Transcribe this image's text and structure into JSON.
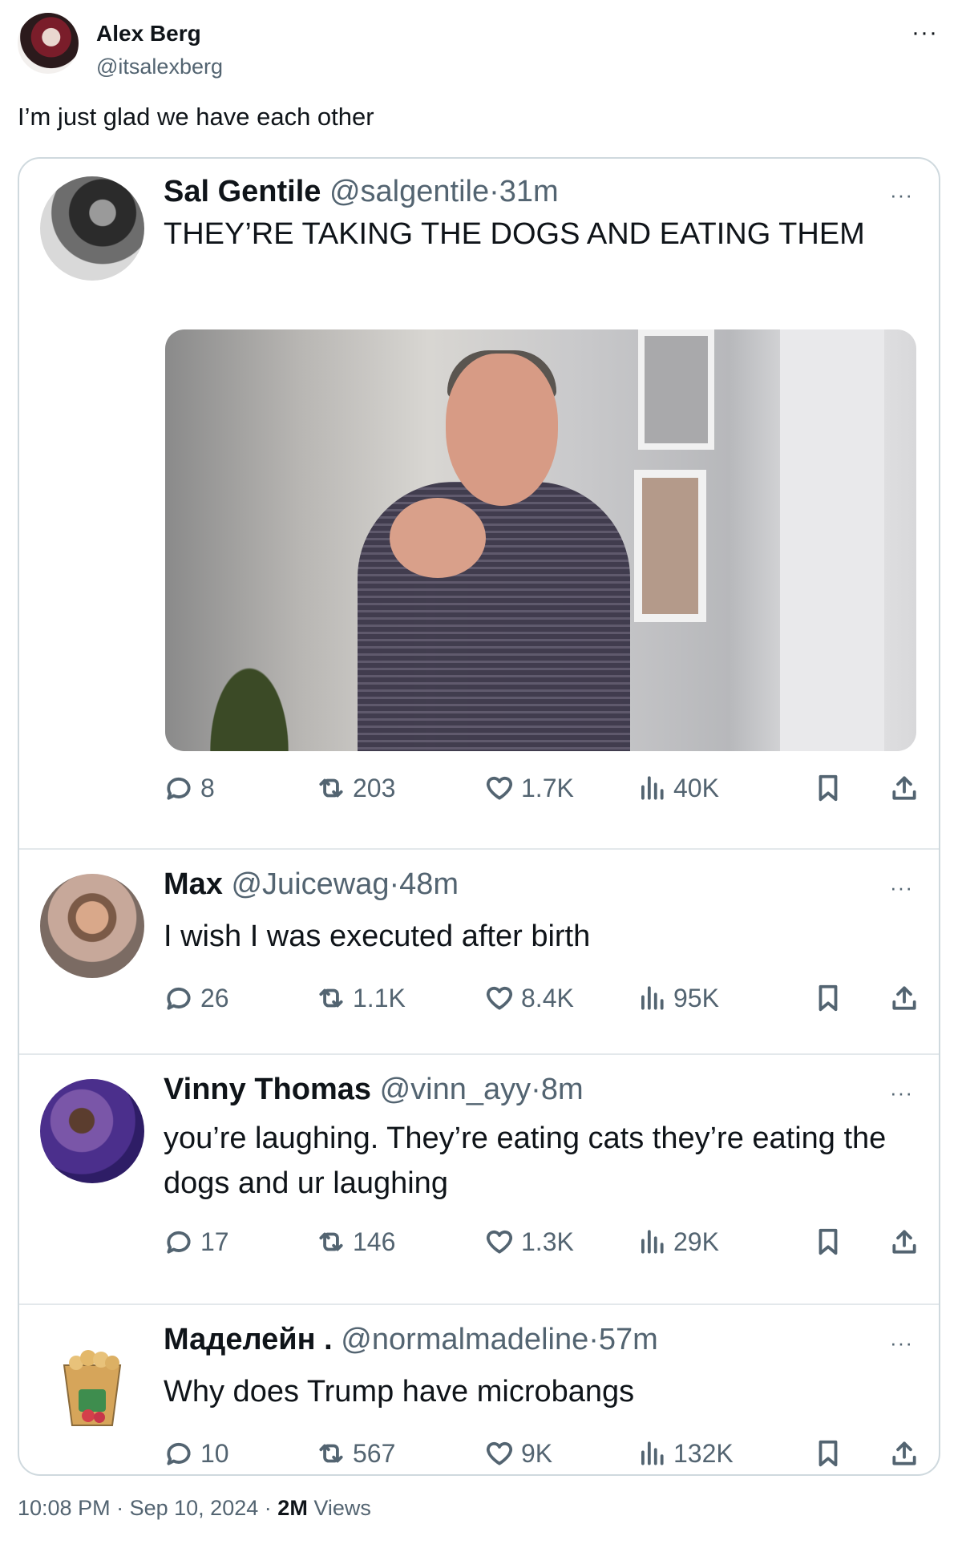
{
  "outer": {
    "name": "Alex Berg",
    "handle": "@itsalexberg",
    "text": "I’m just glad we have each other",
    "more": "···"
  },
  "quoted": {
    "name": "Sal Gentile",
    "handle": "@salgentile",
    "time": "31m",
    "text": "THEY’RE TAKING THE DOGS AND EATING THEM",
    "stats": {
      "replies": "8",
      "reposts": "203",
      "likes": "1.7K",
      "views": "40K"
    }
  },
  "replies": [
    {
      "name": "Max",
      "handle": "@Juicewag",
      "time": "48m",
      "text": "I wish I was executed after birth",
      "stats": {
        "replies": "26",
        "reposts": "1.1K",
        "likes": "8.4K",
        "views": "95K"
      }
    },
    {
      "name": "Vinny Thomas",
      "handle": "@vinn_ayy",
      "time": "8m",
      "text": "you’re laughing. They’re eating cats they’re eating the dogs and ur laughing",
      "stats": {
        "replies": "17",
        "reposts": "146",
        "likes": "1.3K",
        "views": "29K"
      }
    },
    {
      "name": "Маделейн .",
      "handle": "@normalmadeline",
      "time": "57m",
      "text": "Why does Trump have microbangs",
      "stats": {
        "replies": "10",
        "reposts": "567",
        "likes": "9K",
        "views": "132K"
      }
    }
  ],
  "separator": "·",
  "more_glyph": "···",
  "footer": {
    "time": "10:08 PM",
    "date": "Sep 10, 2024",
    "views_count": "2M",
    "views_label": "Views"
  },
  "colors": {
    "text": "#0f1419",
    "muted": "#536471",
    "border": "#cfd9de"
  }
}
